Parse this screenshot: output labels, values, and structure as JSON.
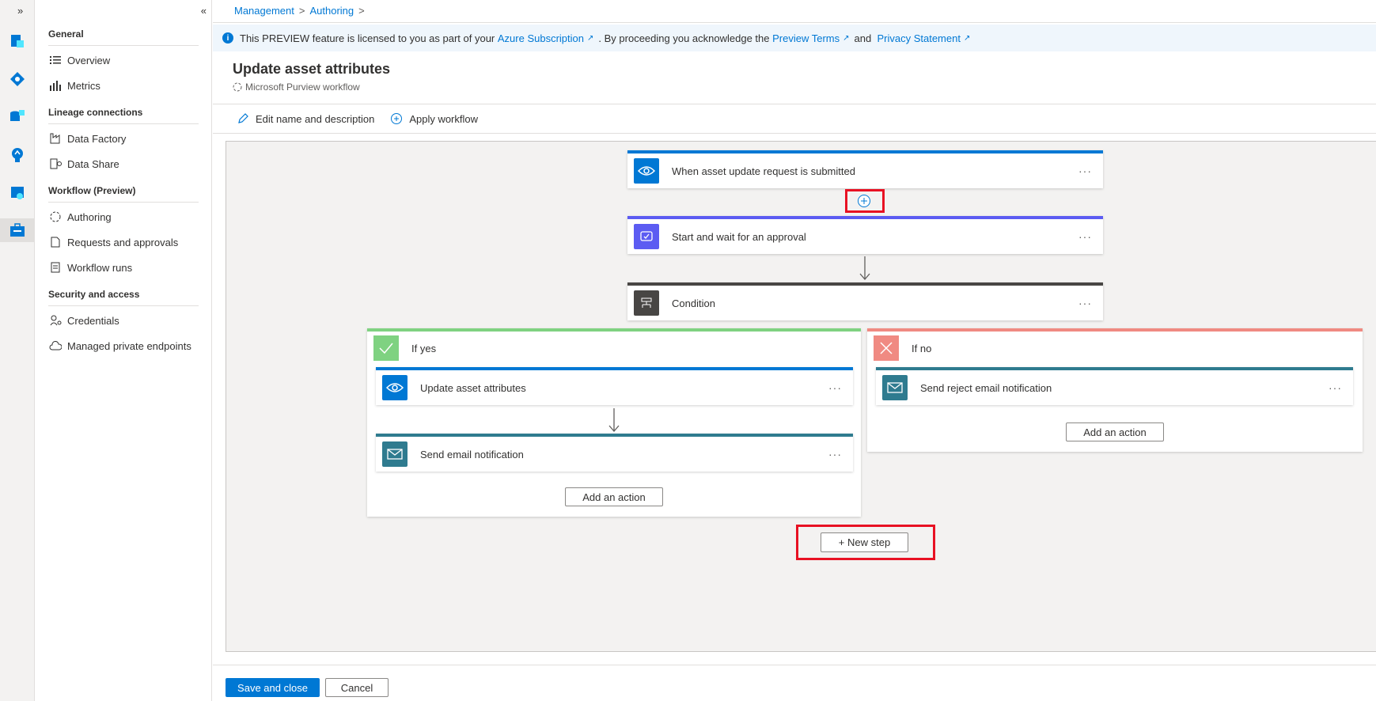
{
  "rail": {
    "expand_glyph": "»",
    "icons": [
      "data-map-icon",
      "data-catalog-icon",
      "data-sources-icon",
      "insights-icon",
      "policy-icon",
      "management-icon"
    ]
  },
  "nav": {
    "collapse_glyph": "«",
    "sections": {
      "general": "General",
      "lineage": "Lineage connections",
      "workflow": "Workflow (Preview)",
      "security": "Security and access"
    },
    "items": {
      "overview": "Overview",
      "metrics": "Metrics",
      "data_factory": "Data Factory",
      "data_share": "Data Share",
      "authoring": "Authoring",
      "requests": "Requests and approvals",
      "workflow_runs": "Workflow runs",
      "credentials": "Credentials",
      "private_endpoints": "Managed private endpoints"
    }
  },
  "breadcrumb": {
    "management": "Management",
    "authoring": "Authoring",
    "sep": ">"
  },
  "banner": {
    "text1": "This PREVIEW feature is licensed to you as part of your",
    "link1": "Azure Subscription",
    "text2": ". By proceeding you acknowledge the",
    "link2": "Preview Terms",
    "text3": "and",
    "link3": "Privacy Statement"
  },
  "page": {
    "title": "Update asset attributes",
    "subtitle": "Microsoft Purview workflow"
  },
  "toolbar": {
    "edit": "Edit name and description",
    "apply": "Apply workflow"
  },
  "workflow": {
    "trigger": "When asset update request is submitted",
    "approval": "Start and wait for an approval",
    "condition": "Condition",
    "if_yes": {
      "label": "If yes",
      "actions": [
        "Update asset attributes",
        "Send email notification"
      ],
      "add_action": "Add an action"
    },
    "if_no": {
      "label": "If no",
      "actions": [
        "Send reject email notification"
      ],
      "add_action": "Add an action"
    },
    "new_step": "+ New step",
    "more": "···"
  },
  "footer": {
    "save": "Save and close",
    "cancel": "Cancel"
  },
  "colors": {
    "accent": "#0078d4",
    "approval": "#5c5cf2",
    "condition": "#484644",
    "yes": "#7fd281",
    "no": "#f08a82",
    "email": "#2f7b8f",
    "highlight": "#e81123"
  }
}
